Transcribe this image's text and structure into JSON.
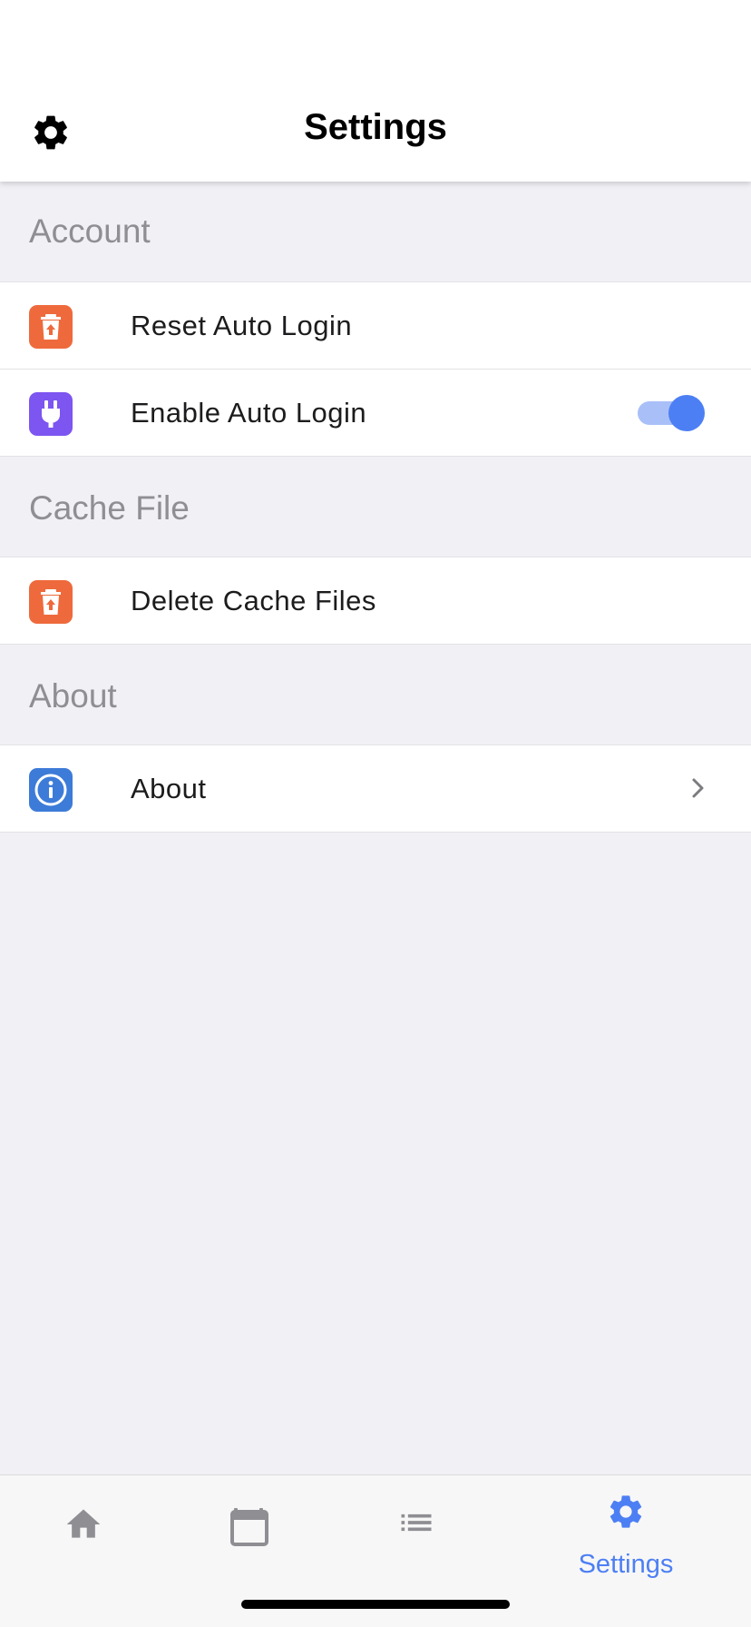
{
  "header": {
    "title": "Settings"
  },
  "sections": [
    {
      "title": "Account",
      "rows": [
        {
          "label": "Reset Auto Login",
          "icon": "trash-upload-icon",
          "icon_color": "#ee6a3c"
        },
        {
          "label": "Enable Auto Login",
          "icon": "plug-icon",
          "icon_color": "#7d55f0",
          "toggle_on": true
        }
      ]
    },
    {
      "title": "Cache File",
      "rows": [
        {
          "label": "Delete Cache Files",
          "icon": "trash-upload-icon",
          "icon_color": "#ee6a3c"
        }
      ]
    },
    {
      "title": "About",
      "rows": [
        {
          "label": "About",
          "icon": "info-icon",
          "icon_color": "#3d7bd8"
        }
      ]
    }
  ],
  "tabbar": {
    "tabs": [
      {
        "icon": "home-icon",
        "label": ""
      },
      {
        "icon": "calendar-icon",
        "label": ""
      },
      {
        "icon": "list-icon",
        "label": ""
      },
      {
        "icon": "gear-icon",
        "label": "Settings",
        "active": true
      }
    ]
  },
  "colors": {
    "accent": "#4d7ff4",
    "background": "#f0f0f5",
    "section_text": "#8e8e93",
    "inactive_tab": "#8e8e93"
  }
}
